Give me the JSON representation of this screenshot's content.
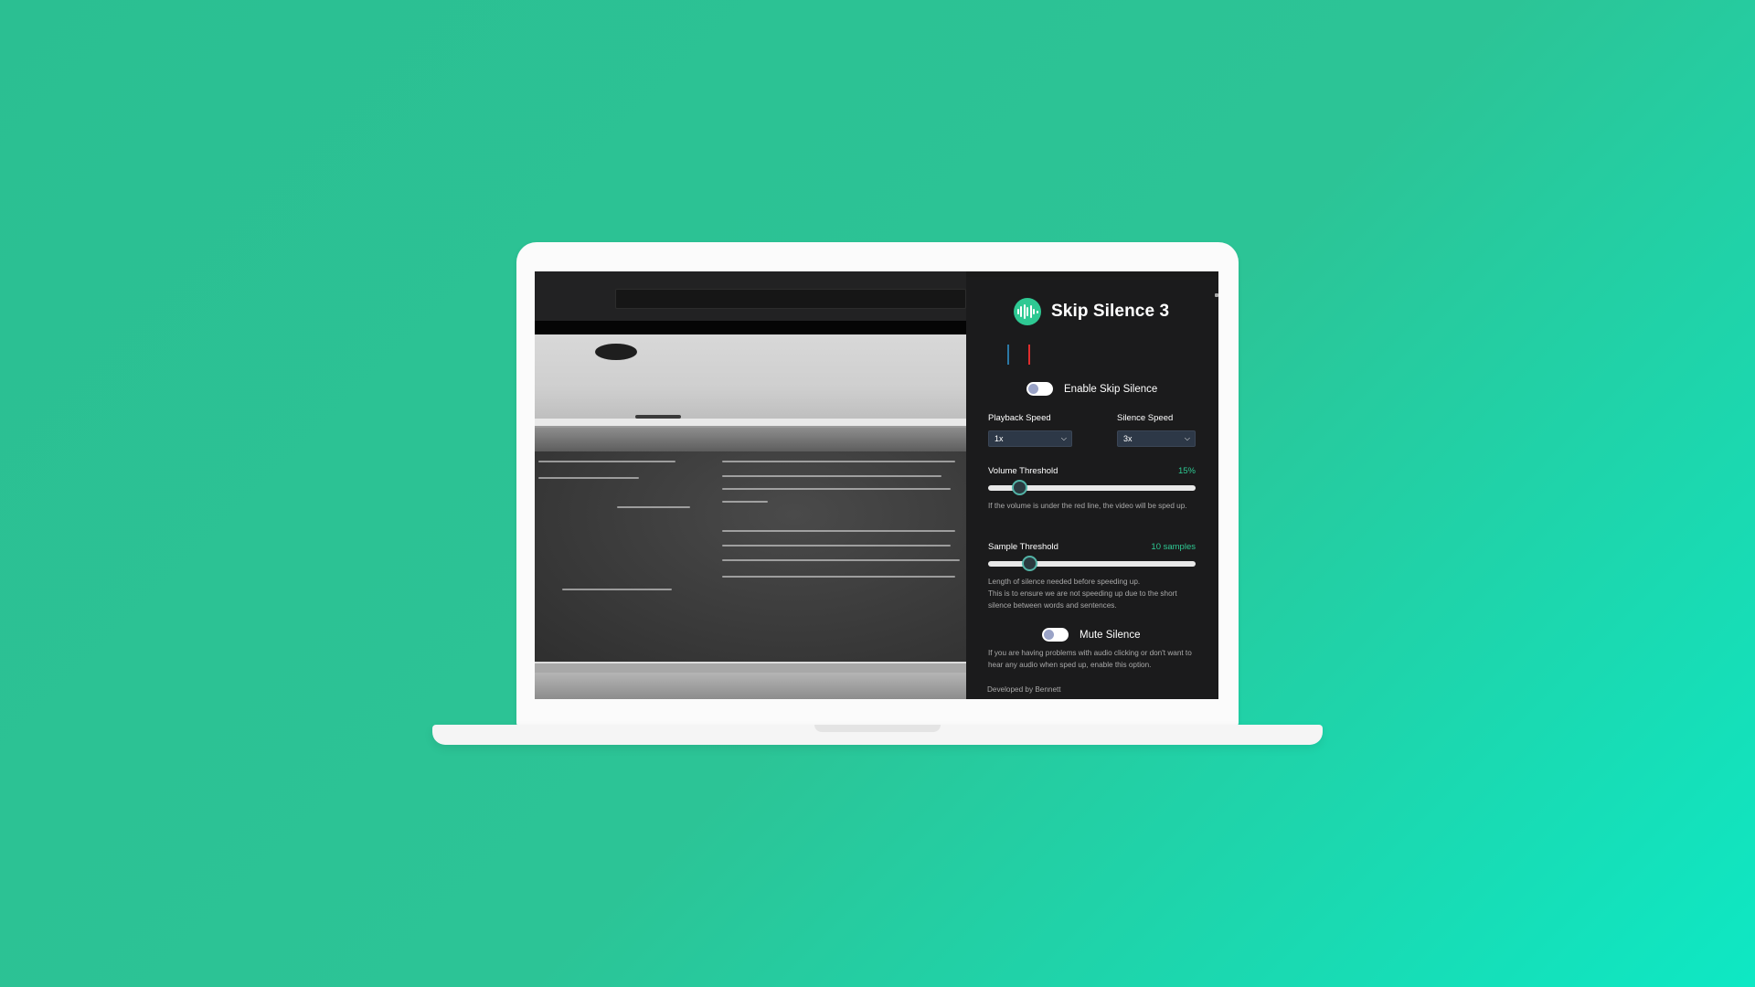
{
  "app": {
    "title": "Skip Silence 3",
    "icon": "waveform-icon",
    "accent_color": "#2ec993"
  },
  "enable_toggle": {
    "label": "Enable Skip Silence",
    "on": false
  },
  "playback_speed": {
    "label": "Playback Speed",
    "selected": "1x"
  },
  "silence_speed": {
    "label": "Silence Speed",
    "selected": "3x"
  },
  "volume_threshold": {
    "label": "Volume Threshold",
    "value_text": "15%",
    "value": 0.15,
    "help": "If the volume is under the red line, the video will be sped up."
  },
  "sample_threshold": {
    "label": "Sample Threshold",
    "value_text": "10 samples",
    "value": 0.2,
    "help_line1": "Length of silence needed before speeding up.",
    "help_line2": "This is to ensure we are not speeding up due to the short silence between words and sentences."
  },
  "mute_toggle": {
    "label": "Mute Silence",
    "on": false,
    "help": "If you are having problems with audio clicking or don't want to hear any audio when sped up, enable this option."
  },
  "footer": {
    "text": "Developed by Bennett"
  }
}
